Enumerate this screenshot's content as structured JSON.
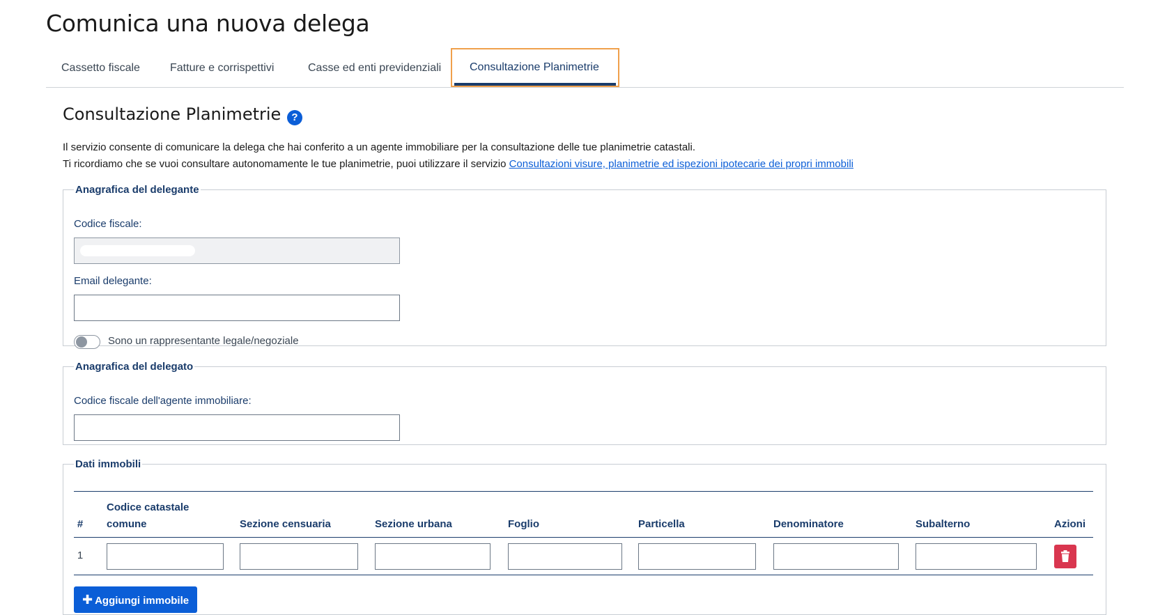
{
  "page": {
    "title": "Comunica una nuova delega"
  },
  "tabs": [
    {
      "label": "Cassetto fiscale"
    },
    {
      "label": "Fatture e corrispettivi"
    },
    {
      "label": "Casse ed enti previdenziali"
    },
    {
      "label": "Consultazione Planimetrie",
      "active": true
    }
  ],
  "section": {
    "title": "Consultazione Planimetrie",
    "help_icon": "question-circle-icon",
    "intro_line1": "Il servizio consente di comunicare la delega che hai conferito a un agente immobiliare per la consultazione delle tue planimetrie catastali.",
    "intro_line2_prefix": "Ti ricordiamo che se vuoi consultare autonomamente le tue planimetrie, puoi utilizzare il servizio ",
    "intro_link": "Consultazioni visure, planimetrie ed ispezioni ipotecarie dei propri immobili"
  },
  "delegante": {
    "legend": "Anagrafica del delegante",
    "codice_fiscale_label": "Codice fiscale:",
    "codice_fiscale_value": "",
    "email_label": "Email delegante:",
    "email_value": "",
    "toggle_label": "Sono un rappresentante legale/negoziale",
    "toggle_on": false
  },
  "delegato": {
    "legend": "Anagrafica del delegato",
    "codice_fiscale_label": "Codice fiscale dell'agente immobiliare:",
    "codice_fiscale_value": ""
  },
  "immobili": {
    "legend": "Dati immobili",
    "headers": {
      "num": "#",
      "codice_line1": "Codice catastale",
      "codice_line2": "comune",
      "sezione_censuaria": "Sezione censuaria",
      "sezione_urbana": "Sezione urbana",
      "foglio": "Foglio",
      "particella": "Particella",
      "denominatore": "Denominatore",
      "subalterno": "Subalterno",
      "azioni": "Azioni"
    },
    "rows": [
      {
        "num": "1",
        "codice": "",
        "sezione_censuaria": "",
        "sezione_urbana": "",
        "foglio": "",
        "particella": "",
        "denominatore": "",
        "subalterno": ""
      }
    ],
    "delete_icon": "trash-icon",
    "add_button": "Aggiungi immobile",
    "add_icon": "plus-icon"
  },
  "colors": {
    "primary": "#0b5ed7",
    "navy": "#1a3c6b",
    "danger": "#d9364f",
    "focus": "#f0a04b"
  }
}
